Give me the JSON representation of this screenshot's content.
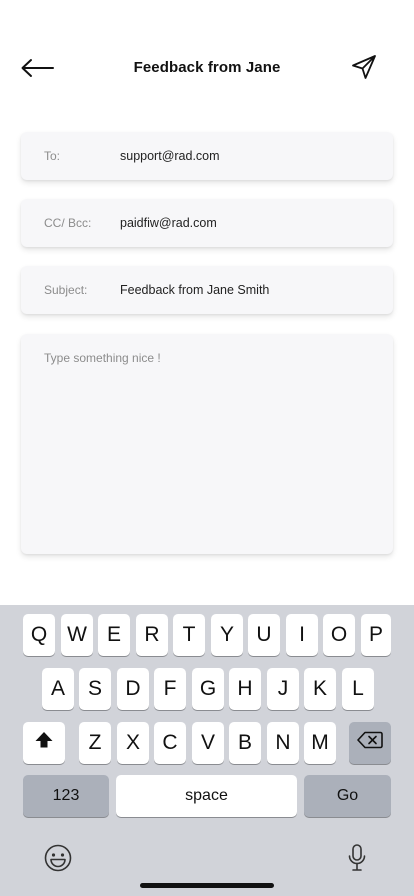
{
  "header": {
    "title": "Feedback from Jane",
    "back_icon": "arrow-left-icon",
    "send_icon": "send-icon"
  },
  "fields": {
    "to": {
      "label": "To:",
      "value": "support@rad.com"
    },
    "cc": {
      "label": "CC/ Bcc:",
      "value": "paidfiw@rad.com"
    },
    "subject": {
      "label": "Subject:",
      "value": "Feedback from Jane Smith"
    }
  },
  "message": {
    "placeholder": "Type something nice !"
  },
  "keyboard": {
    "row1": [
      "Q",
      "W",
      "E",
      "R",
      "T",
      "Y",
      "U",
      "I",
      "O",
      "P"
    ],
    "row2": [
      "A",
      "S",
      "D",
      "F",
      "G",
      "H",
      "J",
      "K",
      "L"
    ],
    "row3": [
      "Z",
      "X",
      "C",
      "V",
      "B",
      "N",
      "M"
    ],
    "numbers_label": "123",
    "space_label": "space",
    "go_label": "Go",
    "shift_icon": "shift-icon",
    "backspace_icon": "backspace-icon",
    "emoji_icon": "emoji-icon",
    "mic_icon": "microphone-icon"
  }
}
